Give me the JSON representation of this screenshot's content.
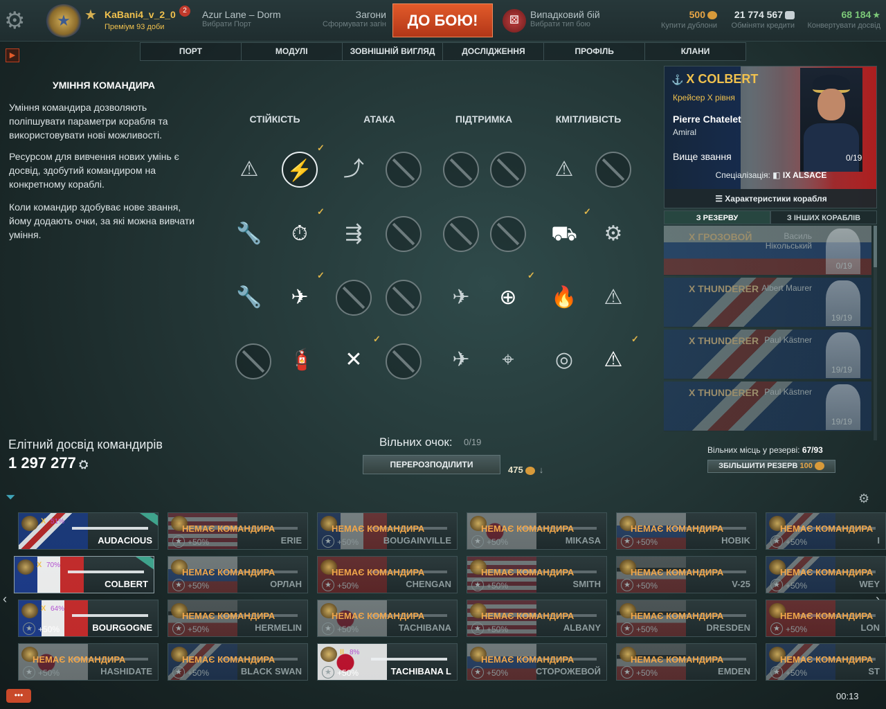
{
  "topbar": {
    "player_name": "KaBani4_v_2_0",
    "notifications": "2",
    "premium": "Преміум 93 доби",
    "port_name": "Azur Lane – Dorm",
    "port_sub": "Вибрати Порт",
    "division": "Загони",
    "division_sub": "Сформувати загін",
    "battle_button": "ДО БОЮ!",
    "battle_type": "Випадковий бій",
    "battle_type_sub": "Вибрати тип бою",
    "doubloons": "500",
    "doubloons_sub": "Купити дублони",
    "credits": "21 774 567",
    "credits_sub": "Обміняти кредити",
    "free_xp": "68 184",
    "free_xp_sub": "Конвертувати досвід"
  },
  "nav": [
    "ПОРТ",
    "МОДУЛІ",
    "ЗОВНІШНІЙ ВИГЛЯД",
    "ДОСЛІДЖЕННЯ",
    "ПРОФІЛЬ",
    "КЛАНИ"
  ],
  "skills_info": {
    "title": "УМІННЯ КОМАНДИРА",
    "p1": "Уміння командира дозволяють поліпшувати параметри корабля та використовувати нові можливості.",
    "p2": "Ресурсом для вивчення нових умінь є досвід, здобутий командиром на конкретному кораблі.",
    "p3": "Коли командир здобуває нове звання, йому додають очки, за які можна вивчати уміння."
  },
  "categories": [
    "СТІЙКІСТЬ",
    "АТАКА",
    "ПІДТРИМКА",
    "КМІТЛИВІСТЬ"
  ],
  "elite": {
    "label": "Елітний досвід командирів",
    "value": "1 297 277"
  },
  "free_points": {
    "label": "Вільних очок:",
    "value": "0/19"
  },
  "redistribute": {
    "label": "ПЕРЕРОЗПОДІЛИТИ",
    "cost": "475"
  },
  "commander": {
    "ship": "X COLBERT",
    "ship_type": "Крейсер X рівня",
    "name": "Pierre Chatelet",
    "rank": "Amiral",
    "next_rank": "Вище звання",
    "points": "0/19",
    "spec_label": "Спеціалізація:",
    "spec_ship": "IX ALSACE",
    "chars_button": "Характеристики корабля"
  },
  "reserve_tabs": [
    "З РЕЗЕРВУ",
    "З ІНШИХ КОРАБЛІВ"
  ],
  "reserve": [
    {
      "ship": "X ГРОЗОВОЙ",
      "name": "Василь Нікольський",
      "points": "0/19"
    },
    {
      "ship": "X THUNDERER",
      "name": "Albert Maurer",
      "points": "19/19"
    },
    {
      "ship": "X THUNDERER",
      "name": "Paul Kästner",
      "points": "19/19"
    },
    {
      "ship": "X THUNDERER",
      "name": "Paul Kästner",
      "points": "19/19"
    }
  ],
  "reserve_slots": {
    "label": "Вільних місць у резерві:",
    "value": "67/93"
  },
  "increase_reserve": {
    "label": "ЗБІЛЬШИТИ РЕЗЕРВ",
    "cost": "100"
  },
  "no_commander": "НЕМАЄ КОМАНДИРА",
  "bonus": "+50%",
  "ships": [
    {
      "name": "AUDACIOUS",
      "tier": "X",
      "pct": "51%",
      "active": true,
      "flag": "uk"
    },
    {
      "name": "ERIE",
      "active": false,
      "flag": "us"
    },
    {
      "name": "BOUGAINVILLE",
      "active": false,
      "flag": "fr"
    },
    {
      "name": "MIKASA",
      "active": false,
      "flag": "jp"
    },
    {
      "name": "HOBIK",
      "active": false,
      "flag": "ru"
    },
    {
      "name": "I",
      "active": false,
      "flag": "uk"
    },
    {
      "name": "COLBERT",
      "tier": "X",
      "pct": "70%",
      "active": true,
      "flag": "fr",
      "selected": true
    },
    {
      "name": "ОРЛАН",
      "active": false,
      "flag": "ru"
    },
    {
      "name": "CHENGAN",
      "active": false,
      "flag": "cn"
    },
    {
      "name": "SMITH",
      "active": false,
      "flag": "us"
    },
    {
      "name": "V-25",
      "active": false,
      "flag": "de"
    },
    {
      "name": "WEY",
      "active": false,
      "flag": "uk"
    },
    {
      "name": "BOURGOGNE",
      "tier": "X",
      "pct": "64%",
      "active": true,
      "flag": "fr",
      "star": true
    },
    {
      "name": "HERMELIN",
      "active": false,
      "flag": "de"
    },
    {
      "name": "TACHIBANA",
      "active": false,
      "flag": "jp"
    },
    {
      "name": "ALBANY",
      "active": false,
      "flag": "us"
    },
    {
      "name": "DRESDEN",
      "active": false,
      "flag": "de"
    },
    {
      "name": "LON",
      "active": false,
      "flag": "cn"
    },
    {
      "name": "HASHIDATE",
      "active": false,
      "flag": "jp"
    },
    {
      "name": "BLACK SWAN",
      "active": false,
      "flag": "uk"
    },
    {
      "name": "TACHIBANA L",
      "tier": "II",
      "pct": "8%",
      "active": true,
      "flag": "jp",
      "star": true
    },
    {
      "name": "СТОРОЖЕВОЙ",
      "active": false,
      "flag": "ru"
    },
    {
      "name": "EMDEN",
      "active": false,
      "flag": "de"
    },
    {
      "name": "ST",
      "active": false,
      "flag": "uk"
    }
  ],
  "clock": "00:13",
  "colors": {
    "accent": "#f0c14e",
    "battle": "#c9492a",
    "no_commander": "#f0a64a"
  }
}
